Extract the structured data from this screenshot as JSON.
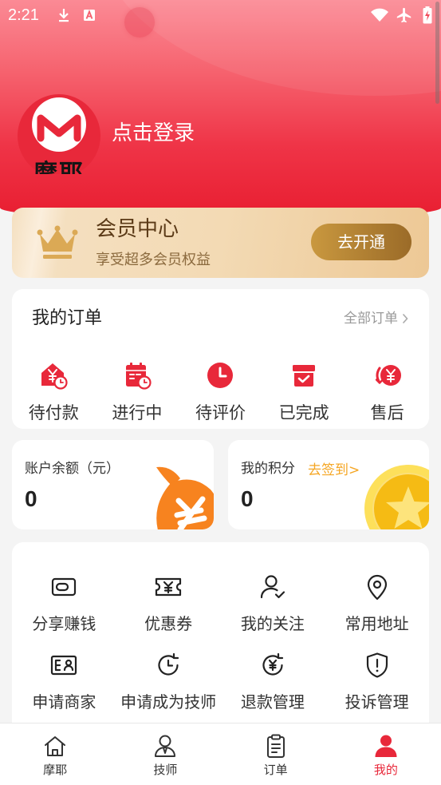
{
  "status_bar": {
    "time": "2:21",
    "left_icons": [
      "download-icon",
      "a-box-icon"
    ],
    "right_icons": [
      "wifi-icon",
      "airplane-icon",
      "battery-charging-icon"
    ]
  },
  "profile": {
    "logo_text": "摩耶",
    "login_text": "点击登录"
  },
  "member": {
    "icon": "crown-icon",
    "title": "会员中心",
    "subtitle": "享受超多会员权益",
    "button": "去开通"
  },
  "orders": {
    "title": "我的订单",
    "all_label": "全部订单",
    "all_icon": "chevron-right-icon",
    "items": [
      {
        "label": "待付款",
        "icon": "pending-payment-icon"
      },
      {
        "label": "进行中",
        "icon": "in-progress-calendar-icon"
      },
      {
        "label": "待评价",
        "icon": "review-clock-icon"
      },
      {
        "label": "已完成",
        "icon": "completed-box-icon"
      },
      {
        "label": "售后",
        "icon": "after-sales-icon"
      }
    ]
  },
  "balance": {
    "label": "账户余额（元）",
    "value": "0",
    "icon": "money-bag-icon"
  },
  "points": {
    "label": "我的积分",
    "checkin": "去签到>",
    "value": "0",
    "icon": "gold-coin-icon"
  },
  "services": [
    {
      "label": "分享赚钱",
      "icon": "wallet-icon"
    },
    {
      "label": "优惠券",
      "icon": "coupon-icon"
    },
    {
      "label": "我的关注",
      "icon": "follow-user-icon"
    },
    {
      "label": "常用地址",
      "icon": "location-pin-icon"
    },
    {
      "label": "申请商家",
      "icon": "merchant-card-icon"
    },
    {
      "label": "申请成为技师",
      "icon": "clock-refresh-icon"
    },
    {
      "label": "退款管理",
      "icon": "refund-icon"
    },
    {
      "label": "投诉管理",
      "icon": "shield-alert-icon"
    }
  ],
  "nav": [
    {
      "label": "摩耶",
      "icon": "home-icon",
      "active": false
    },
    {
      "label": "技师",
      "icon": "technician-icon",
      "active": false
    },
    {
      "label": "订单",
      "icon": "clipboard-icon",
      "active": false
    },
    {
      "label": "我的",
      "icon": "user-filled-icon",
      "active": true
    }
  ],
  "colors": {
    "primary": "#e8283a",
    "header_top": "#fb8a95",
    "header_bottom": "#e81d30",
    "member_button": "#b07d33",
    "member_text": "#5b3a17",
    "checkin": "#f5a623",
    "money_bag": "#f7831f",
    "coin": "#f5bb14"
  }
}
